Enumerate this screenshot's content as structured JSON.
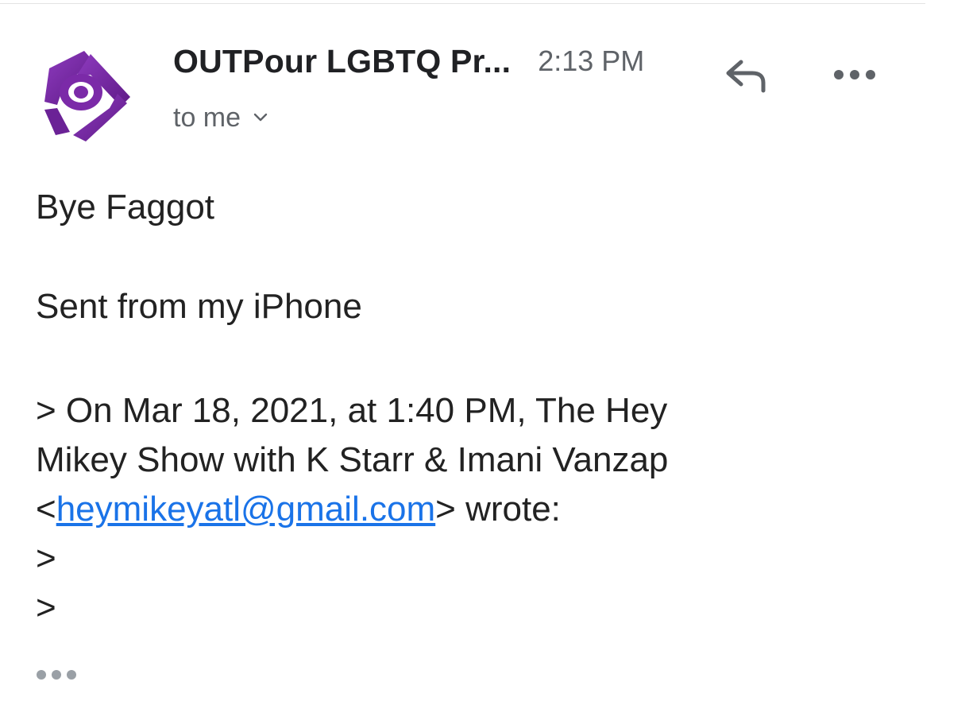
{
  "email": {
    "sender_name": "OUTPour LGBTQ Pr...",
    "time": "2:13 PM",
    "recipient": "to me",
    "body_line_1": "Bye Faggot",
    "signature": "Sent from my iPhone",
    "quote": {
      "line_1": "> On Mar 18, 2021, at 1:40 PM, The Hey",
      "line_2": "Mikey Show with K Starr & Imani Vanzap",
      "line_3_prefix": "<",
      "email_link": "heymikeyatl@gmail.com",
      "line_3_suffix": "> wrote:",
      "line_4": ">",
      "line_5": ">"
    }
  },
  "icons": {
    "avatar": "logo-avatar-icon",
    "reply": "reply-arrow-icon",
    "more": "more-options-icon",
    "expand": "chevron-down-icon",
    "trimmed": "show-trimmed-content-icon"
  },
  "colors": {
    "logo_purple": "#7b2aa8",
    "link_blue": "#1a73e8",
    "secondary_text": "#5f6368",
    "icon_gray": "#5f6368"
  }
}
